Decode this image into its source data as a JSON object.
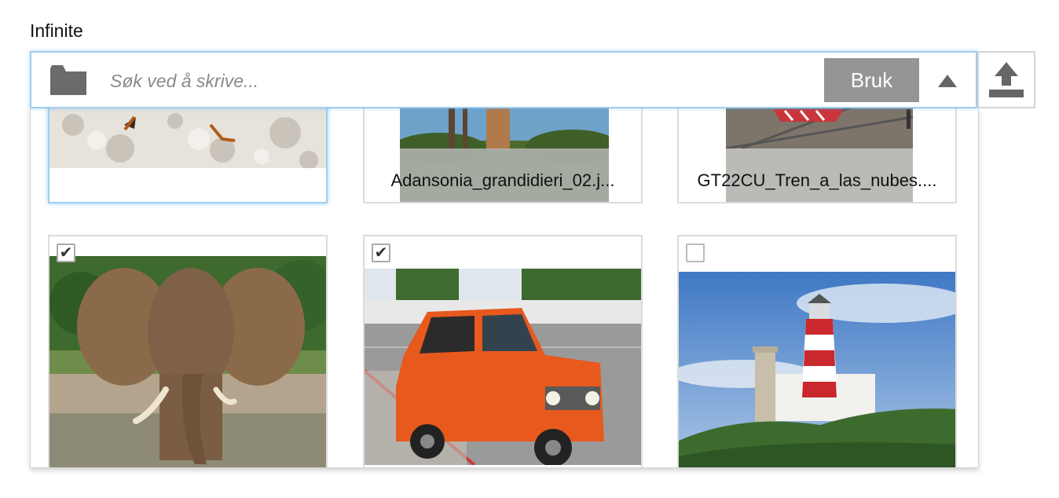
{
  "field": {
    "label": "Infinite"
  },
  "search": {
    "placeholder": "Søk ved å skrive...",
    "value": "",
    "apply_label": "Bruk",
    "folder_icon": "folder-icon",
    "toggle_icon": "triangle-up-icon",
    "upload_icon": "upload-icon"
  },
  "gallery": {
    "items": [
      {
        "caption": "",
        "selected": true,
        "checked": null,
        "image": "bird-on-rocks"
      },
      {
        "caption": "Adansonia_grandidieri_02.j...",
        "selected": false,
        "checked": null,
        "image": "baobab-trees"
      },
      {
        "caption": "GT22CU_Tren_a_las_nubes....",
        "selected": false,
        "checked": null,
        "image": "railway-track"
      },
      {
        "caption": "",
        "selected": false,
        "checked": true,
        "image": "elephant"
      },
      {
        "caption": "",
        "selected": false,
        "checked": true,
        "image": "orange-car"
      },
      {
        "caption": "",
        "selected": false,
        "checked": false,
        "image": "lighthouse"
      }
    ]
  },
  "colors": {
    "focus_border": "#9fcdf0",
    "button_bg": "#959595",
    "icon_gray": "#6b6b6b"
  }
}
